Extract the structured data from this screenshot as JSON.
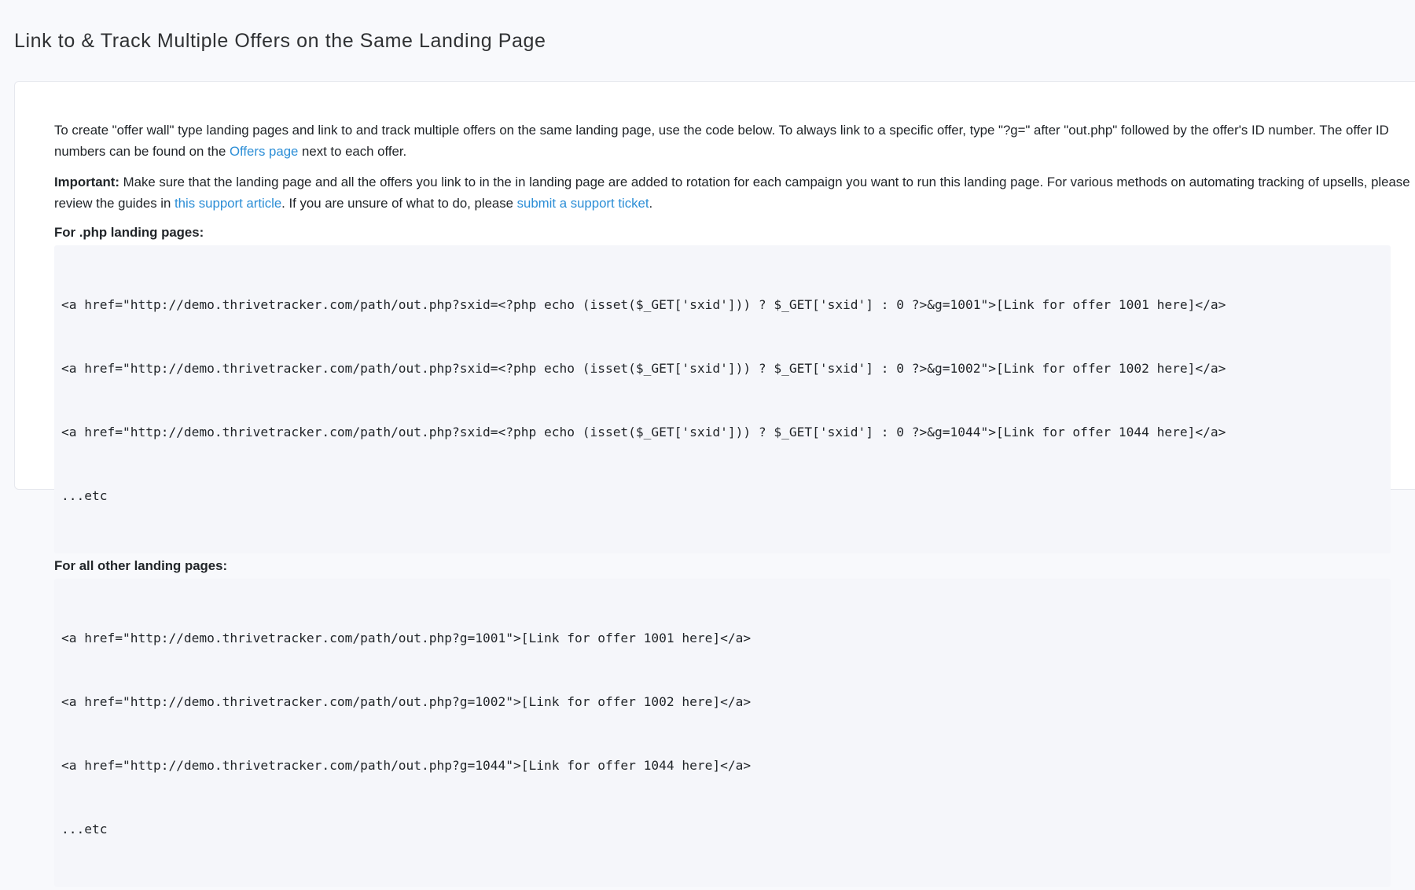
{
  "page": {
    "title": "Link to & Track Multiple Offers on the Same Landing Page"
  },
  "intro": {
    "text_before_link": "To create \"offer wall\" type landing pages and link to and track multiple offers on the same landing page, use the code below. To always link to a specific offer, type \"?g=\" after \"out.php\" followed by the offer's ID number. The offer ID numbers can be found on the ",
    "link_text": "Offers page",
    "text_after_link": " next to each offer."
  },
  "important": {
    "label": "Important:",
    "text_1": " Make sure that the landing page and all the offers you link to in the in landing page are added to rotation for each campaign you want to run this landing page. For various methods on automating tracking of upsells, please review the guides in ",
    "link_1": "this support article",
    "text_2": ". If you are unsure of what to do, please ",
    "link_2": "submit a support ticket",
    "text_3": "."
  },
  "php_section": {
    "heading": "For .php landing pages:",
    "lines": [
      "<a href=\"http://demo.thrivetracker.com/path/out.php?sxid=<?php echo (isset($_GET['sxid'])) ? $_GET['sxid'] : 0 ?>&g=1001\">[Link for offer 1001 here]</a>",
      "<a href=\"http://demo.thrivetracker.com/path/out.php?sxid=<?php echo (isset($_GET['sxid'])) ? $_GET['sxid'] : 0 ?>&g=1002\">[Link for offer 1002 here]</a>",
      "<a href=\"http://demo.thrivetracker.com/path/out.php?sxid=<?php echo (isset($_GET['sxid'])) ? $_GET['sxid'] : 0 ?>&g=1044\">[Link for offer 1044 here]</a>",
      "...etc"
    ]
  },
  "other_section": {
    "heading": "For all other landing pages:",
    "lines": [
      "<a href=\"http://demo.thrivetracker.com/path/out.php?g=1001\">[Link for offer 1001 here]</a>",
      "<a href=\"http://demo.thrivetracker.com/path/out.php?g=1002\">[Link for offer 1002 here]</a>",
      "<a href=\"http://demo.thrivetracker.com/path/out.php?g=1044\">[Link for offer 1044 here]</a>",
      "...etc"
    ]
  },
  "colors": {
    "link": "#2c8ed6",
    "page_background": "#f8f9fc",
    "code_background": "#f5f6fa"
  }
}
